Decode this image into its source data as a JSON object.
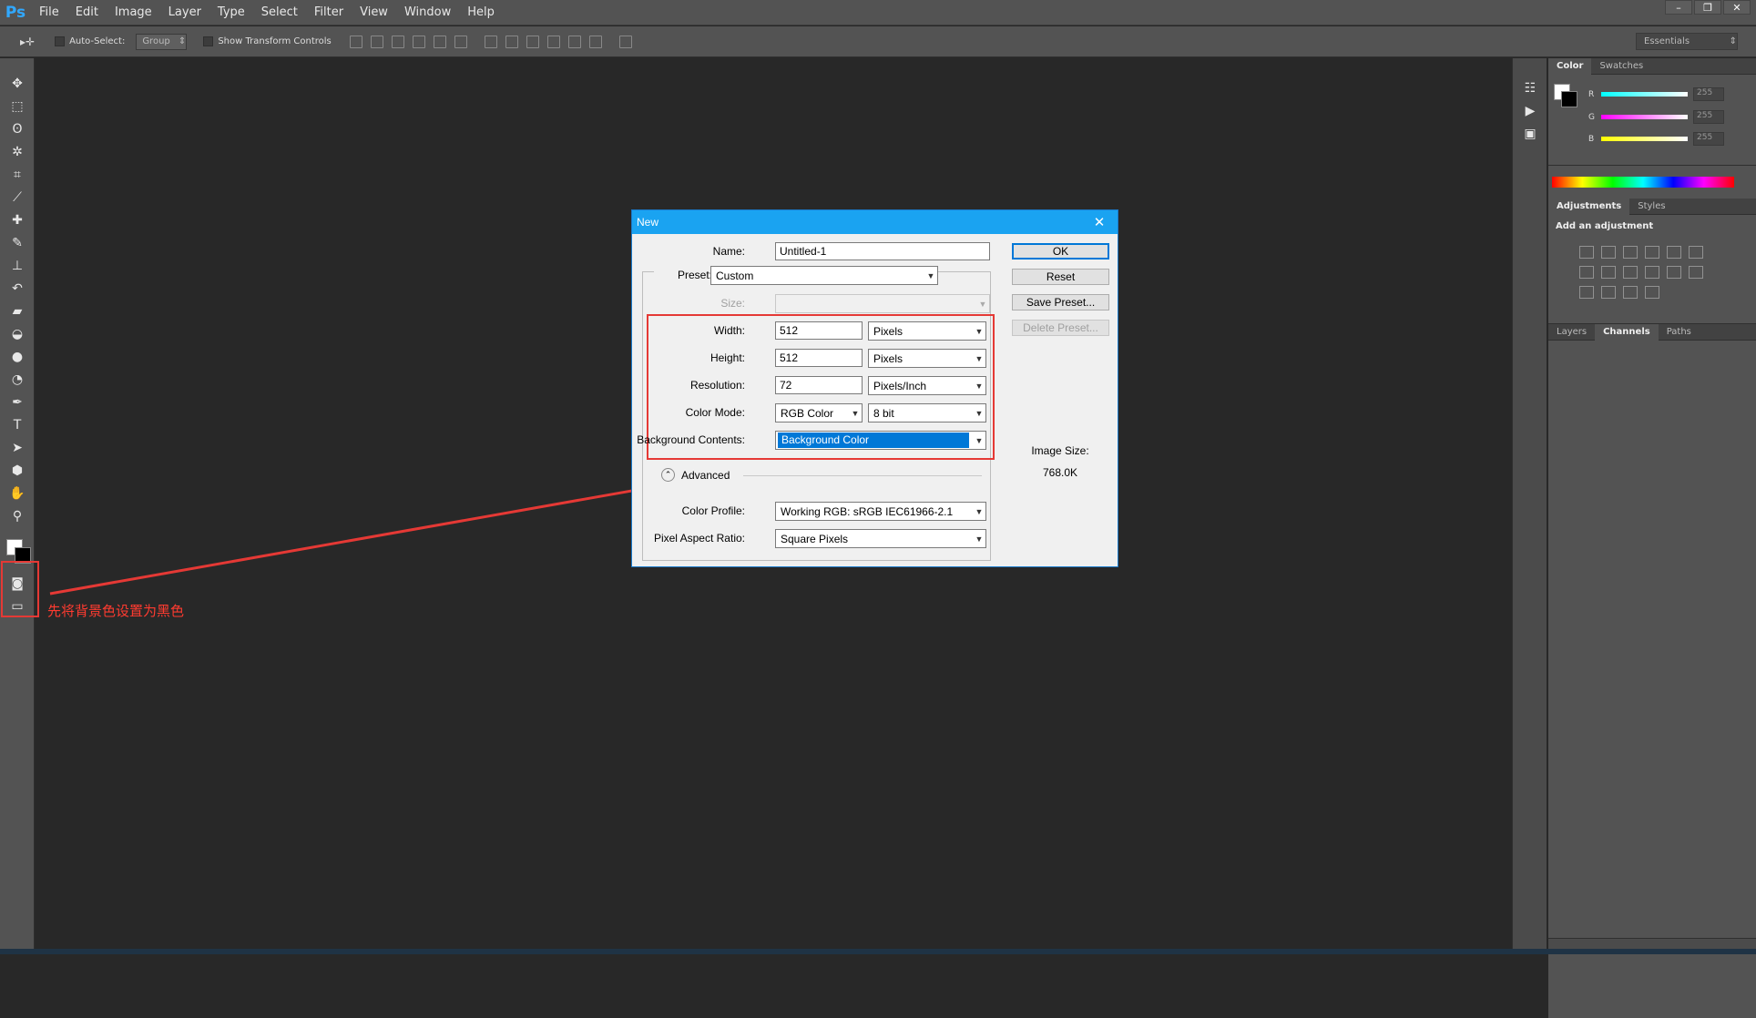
{
  "app": {
    "logo": "Ps"
  },
  "menu": [
    "File",
    "Edit",
    "Image",
    "Layer",
    "Type",
    "Select",
    "Filter",
    "View",
    "Window",
    "Help"
  ],
  "window_controls": {
    "minimize": "–",
    "restore": "❐",
    "close": "✕"
  },
  "options": {
    "auto_select_label": "Auto-Select:",
    "group_value": "Group",
    "transform_label": "Show Transform Controls",
    "workspace": "Essentials"
  },
  "annotation": {
    "text": "先将背景色设置为黑色",
    "color": "#ff3b30"
  },
  "panels": {
    "color_tabs": [
      "Color",
      "Swatches"
    ],
    "rgb": [
      {
        "label": "R",
        "value": "255"
      },
      {
        "label": "G",
        "value": "255"
      },
      {
        "label": "B",
        "value": "255"
      }
    ],
    "adjust_tabs": [
      "Adjustments",
      "Styles"
    ],
    "add_adjustment": "Add an adjustment",
    "layer_tabs": [
      "Layers",
      "Channels",
      "Paths"
    ]
  },
  "dialog": {
    "title": "New",
    "name_label": "Name:",
    "name_value": "Untitled-1",
    "preset_label": "Preset:",
    "preset_value": "Custom",
    "size_label": "Size:",
    "width_label": "Width:",
    "width_value": "512",
    "width_unit": "Pixels",
    "height_label": "Height:",
    "height_value": "512",
    "height_unit": "Pixels",
    "resolution_label": "Resolution:",
    "resolution_value": "72",
    "resolution_unit": "Pixels/Inch",
    "color_mode_label": "Color Mode:",
    "color_mode_value": "RGB Color",
    "bit_depth_value": "8 bit",
    "bg_contents_label": "Background Contents:",
    "bg_contents_value": "Background Color",
    "advanced_label": "Advanced",
    "color_profile_label": "Color Profile:",
    "color_profile_value": "Working RGB:  sRGB IEC61966-2.1",
    "pixel_aspect_label": "Pixel Aspect Ratio:",
    "pixel_aspect_value": "Square Pixels",
    "buttons": {
      "ok": "OK",
      "reset": "Reset",
      "save_preset": "Save Preset...",
      "delete_preset": "Delete Preset..."
    },
    "image_size_label": "Image Size:",
    "image_size_value": "768.0K"
  }
}
